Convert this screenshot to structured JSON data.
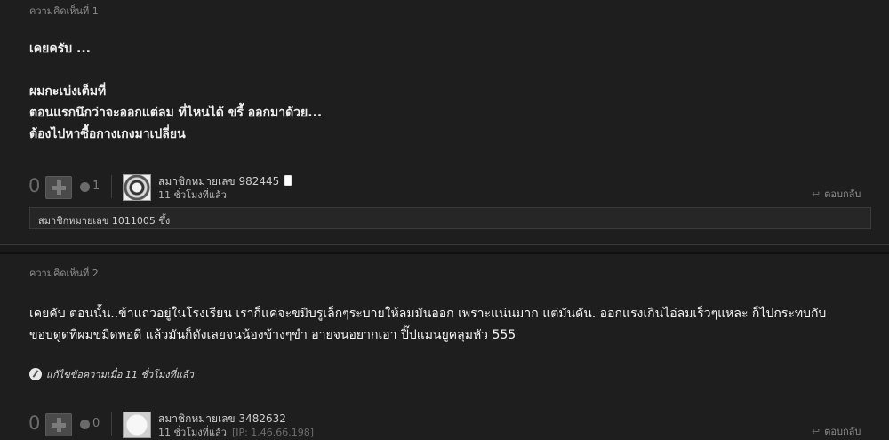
{
  "comments": [
    {
      "header": "ความคิดเห็นที่ 1",
      "body_lines": [
        "เคยครับ ...",
        "",
        "ผมกะเบ่งเต็มที่",
        "ตอนแรกนึกว่าจะออกแต่ลม  ที่ไหนได้ ขรี้ ออกมาด้วย...",
        "ต้องไปหาซื้อกางเกงมาเปลี่ยน"
      ],
      "vote_count": "0",
      "emotion_count": "1",
      "user_name": "สมาชิกหมายเลข 982445",
      "time": "11 ชั่วโมงที่แล้ว",
      "reply_label": "ตอบกลับ",
      "reaction_text": "สมาชิกหมายเลข 1011005 ซึ้ง"
    },
    {
      "header": "ความคิดเห็นที่ 2",
      "body_lines": [
        "เคยคับ ตอนนั้น..ข้าแถวอยู่ในโรงเรียน เราก็แค่จะขมิบรูเล็กๆระบายให้ลมมันออก เพราะแน่นมาก แต่มันดัน. ออกแรงเกินไอ่ลมเร็วๆแหละ ก็ไปกระทบกับ",
        "ขอบดูดที่ผมขมิดพอดี แล้วมันก็ดังเลยจนน้องข้างๆขำ อายจนอยากเอา ปิ๊ปแมนยูคลุมหัว 555"
      ],
      "edit_note": "แก้ไขข้อความเมื่อ 11 ชั่วโมงที่แล้ว",
      "vote_count": "0",
      "emotion_count": "0",
      "user_name": "สมาชิกหมายเลข 3482632",
      "time": "11 ชั่วโมงที่แล้ว",
      "ip": "[IP: 1.46.66.198]",
      "reply_label": "ตอบกลับ"
    }
  ]
}
